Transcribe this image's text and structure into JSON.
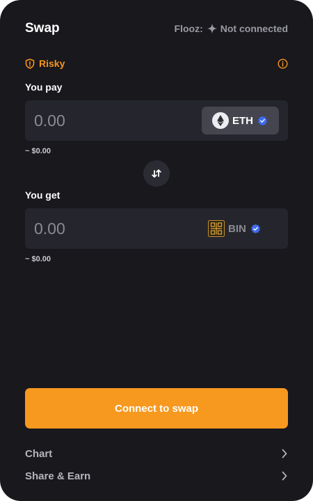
{
  "header": {
    "title": "Swap",
    "platform_label": "Flooz:",
    "connection_status": "Not connected"
  },
  "risk": {
    "label": "Risky",
    "color": "#f7941d"
  },
  "pay": {
    "label": "You pay",
    "amount_placeholder": "0.00",
    "token_symbol": "ETH",
    "token_icon": "ethereum-icon",
    "usd_value": "~ $0.00"
  },
  "receive": {
    "label": "You get",
    "amount_placeholder": "0.00",
    "token_symbol": "BIN",
    "token_icon": "bin-token-icon",
    "usd_value": "~ $0.00"
  },
  "actions": {
    "primary": "Connect to swap",
    "primary_color": "#f7991f"
  },
  "links": [
    {
      "label": "Chart"
    },
    {
      "label": "Share & Earn"
    }
  ]
}
